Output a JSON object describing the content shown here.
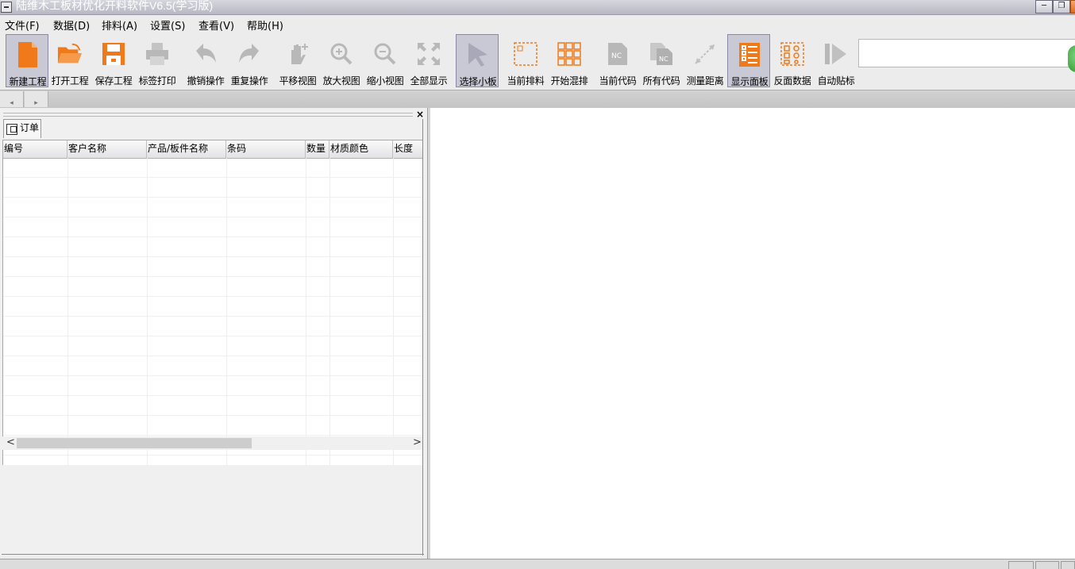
{
  "window": {
    "title": "陆维木工板材优化开料软件V6.5(学习版)",
    "min_icon": "minimize-icon",
    "restore_icon": "restore-icon",
    "close_icon": "close-icon"
  },
  "menu": [
    {
      "label": "文件(F)"
    },
    {
      "label": "数据(D)"
    },
    {
      "label": "排料(A)"
    },
    {
      "label": "设置(S)"
    },
    {
      "label": "查看(V)"
    },
    {
      "label": "帮助(H)"
    }
  ],
  "toolbar": [
    {
      "label": "新建工程",
      "icon": "new-document-icon",
      "active": true
    },
    {
      "label": "打开工程",
      "icon": "open-folder-icon"
    },
    {
      "label": "保存工程",
      "icon": "save-disk-icon"
    },
    {
      "label": "标签打印",
      "icon": "printer-icon"
    },
    {
      "label": "撤销操作",
      "icon": "undo-icon"
    },
    {
      "label": "重复操作",
      "icon": "redo-icon"
    },
    {
      "label": "平移视图",
      "icon": "pan-hand-icon"
    },
    {
      "label": "放大视图",
      "icon": "zoom-in-icon"
    },
    {
      "label": "缩小视图",
      "icon": "zoom-out-icon"
    },
    {
      "label": "全部显示",
      "icon": "fit-all-icon"
    },
    {
      "label": "选择小板",
      "icon": "select-pointer-icon",
      "active": true
    },
    {
      "label": "当前排料",
      "icon": "current-nesting-icon"
    },
    {
      "label": "开始混排",
      "icon": "mixed-nesting-icon"
    },
    {
      "label": "当前代码",
      "icon": "nc-code-icon"
    },
    {
      "label": "所有代码",
      "icon": "all-nc-code-icon"
    },
    {
      "label": "测量距离",
      "icon": "measure-icon"
    },
    {
      "label": "显示面板",
      "icon": "show-panel-icon",
      "active": true
    },
    {
      "label": "反面数据",
      "icon": "reverse-data-icon"
    },
    {
      "label": "自动贴标",
      "icon": "auto-label-icon"
    }
  ],
  "nav": {
    "prev": "◂",
    "next": "▸"
  },
  "panel": {
    "close": "×",
    "tab_label": "订单",
    "columns": [
      "编号",
      "客户名称",
      "产品/板件名称",
      "条码",
      "数量",
      "材质颜色",
      "长度"
    ]
  },
  "scroll": {
    "left": "<",
    "right": ">"
  },
  "colors": {
    "accent": "#f07a1a",
    "disabled": "#b8b8b8",
    "active_bg": "#c9c9d6"
  }
}
